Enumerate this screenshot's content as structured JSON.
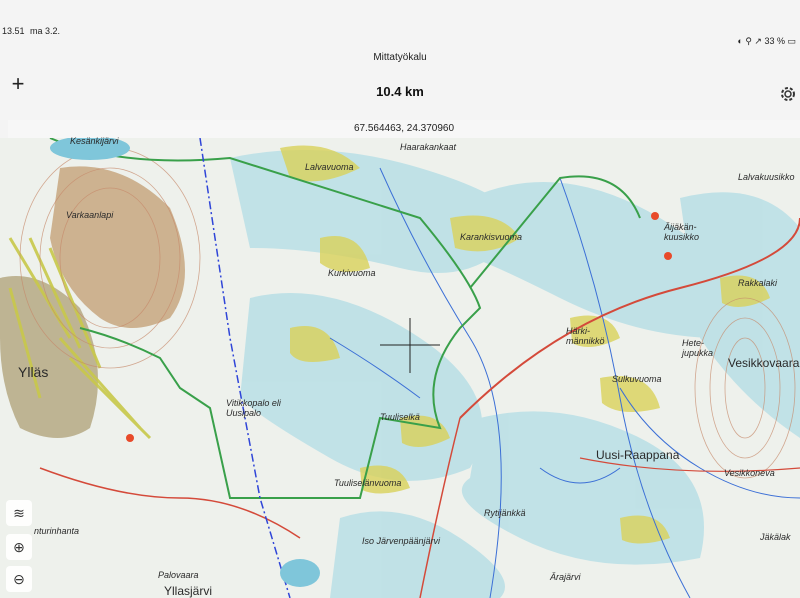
{
  "status": {
    "time": "13.51",
    "date": "ma 3.2.",
    "battery": "33 %"
  },
  "nav": {
    "title": "Mittatyökalu",
    "value": "10.4 km",
    "add_icon": "plus-icon",
    "settings_icon": "gear-icon"
  },
  "coords": "67.564463, 24.370960",
  "map_labels": {
    "haarakankaat": "Haarakankaat",
    "lalvavuoma": "Lalvavuoma",
    "lalvakuusikko": "Lalvakuusikko",
    "karankisvuoma": "Karankisvuoma",
    "ajakan": "Äijäkän-\nkuusikko",
    "rakkalaki": "Rakkalaki",
    "kurkivuoma": "Kurkivuoma",
    "harkimannikko": "Härki-\nmännikkö",
    "hete": "Hete-\njupukka",
    "vesikkovaara": "Vesikkovaara",
    "sulkuvuoma": "Sulkuvuoma",
    "vitikkopalo": "Vitikkopalo eli\nUusipalo",
    "tuuliselka": "Tuuliselkä",
    "uusi_raappana": "Uusi-Raappana",
    "yllas": "Ylläs",
    "tuuliselanvuoma": "Tuuliselänvuoma",
    "rytijankka": "Rytijänkkä",
    "jakalak": "Jäkälak",
    "iso_jarvi": "Iso Järvenpäänjärvi",
    "palovaara": "Palovaara",
    "yllasjarvi": "Yllasjärvi",
    "antinhanta": "nturinhanta",
    "arajarvi": "Ärajärvi",
    "varkaan": "Varkaanlapi",
    "kesankijarvi": "Kesänkijärvi",
    "vesikkonen": "Vesikkoneva"
  },
  "controls": {
    "layers_icon": "layers-icon",
    "zoom_in_icon": "zoom-in-icon",
    "zoom_out_icon": "zoom-out-icon"
  }
}
